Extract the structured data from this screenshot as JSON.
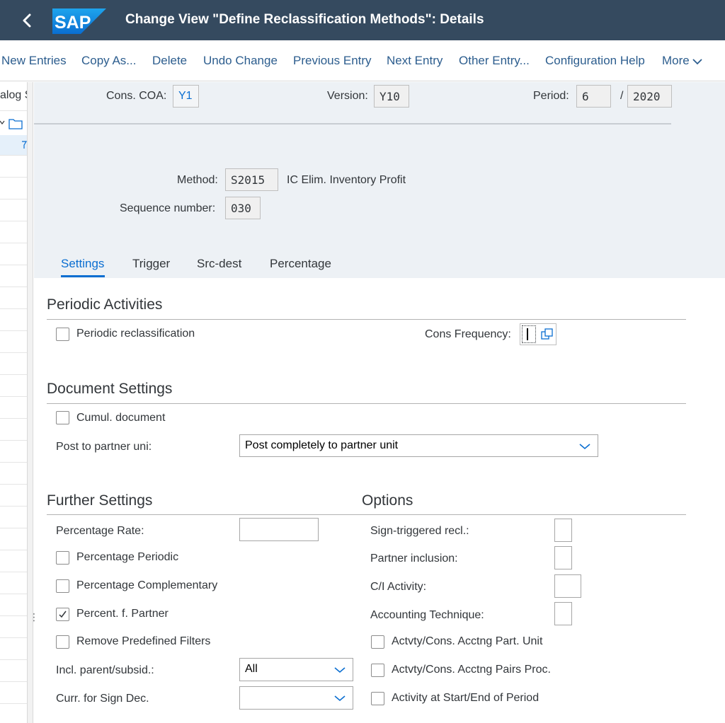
{
  "shell": {
    "title": "Change View \"Define Reclassification Methods\": Details",
    "logo_text": "SAP",
    "brand_color": "#354a5f"
  },
  "toolbar": {
    "new_entries": "New Entries",
    "copy_as": "Copy As...",
    "delete": "Delete",
    "undo_change": "Undo Change",
    "previous_entry": "Previous Entry",
    "next_entry": "Next Entry",
    "other_entry": "Other Entry...",
    "configuration_help": "Configuration Help",
    "more": "More"
  },
  "left_pane": {
    "header_partial": "alog S"
  },
  "header": {
    "cons_coa_label": "Cons. COA:",
    "cons_coa_value": "Y1",
    "version_label": "Version:",
    "version_value": "Y10",
    "period_label": "Period:",
    "period_value": "6",
    "period_separator": "/",
    "year_value": "2020",
    "method_label": "Method:",
    "method_value": "S2015",
    "method_description": "IC Elim. Inventory Profit",
    "sequence_label": "Sequence number:",
    "sequence_value": "030"
  },
  "tabs": [
    {
      "label": "Settings",
      "active": true
    },
    {
      "label": "Trigger",
      "active": false
    },
    {
      "label": "Src-dest",
      "active": false
    },
    {
      "label": "Percentage",
      "active": false
    }
  ],
  "periodic": {
    "title": "Periodic Activities",
    "periodic_reclassification": "Periodic reclassification",
    "periodic_reclassification_checked": false,
    "cons_frequency_label": "Cons Frequency:",
    "cons_frequency_value": ""
  },
  "document": {
    "title": "Document Settings",
    "cumul_document": "Cumul. document",
    "cumul_document_checked": false,
    "post_to_partner_label": "Post to partner uni:",
    "post_to_partner_value": "Post completely to partner unit"
  },
  "further": {
    "title": "Further Settings",
    "percentage_rate_label": "Percentage Rate:",
    "percentage_rate_value": "",
    "percentage_periodic": "Percentage Periodic",
    "percentage_periodic_checked": false,
    "percentage_complementary": "Percentage Complementary",
    "percentage_complementary_checked": false,
    "percent_f_partner": "Percent. f. Partner",
    "percent_f_partner_checked": true,
    "remove_predefined_filters": "Remove Predefined Filters",
    "remove_predefined_filters_checked": false,
    "incl_parent_label": "Incl. parent/subsid.:",
    "incl_parent_value": "All",
    "curr_sign_label": "Curr. for Sign Dec.",
    "curr_sign_value": ""
  },
  "options": {
    "title": "Options",
    "sign_triggered_label": "Sign-triggered recl.:",
    "partner_inclusion_label": "Partner inclusion:",
    "ci_activity_label": "C/I Activity:",
    "accounting_technique_label": "Accounting Technique:",
    "actvty_part_unit": "Actvty/Cons. Acctng Part. Unit",
    "actvty_part_unit_checked": false,
    "actvty_pairs_proc": "Actvty/Cons. Acctng Pairs Proc.",
    "actvty_pairs_proc_checked": false,
    "activity_start_end": "Activity at Start/End of Period",
    "activity_start_end_checked": false
  }
}
